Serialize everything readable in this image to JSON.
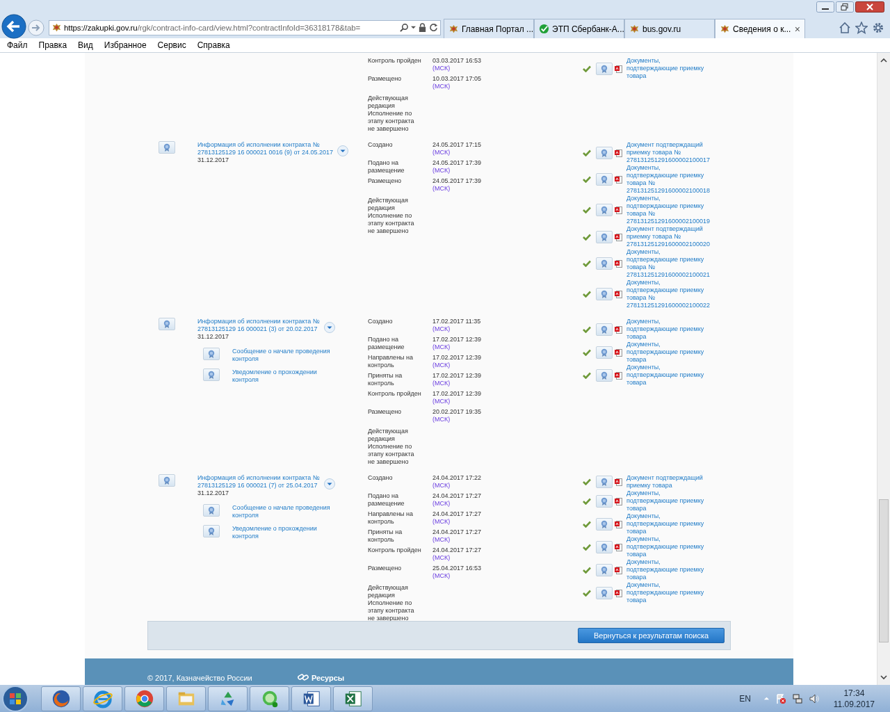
{
  "browser": {
    "url": {
      "host": "https://zakupki.gov.ru",
      "path": "/rgk/contract-info-card/view.html?contractInfoId=36318178&tab="
    },
    "tabs": [
      {
        "label": "Главная Портал ...",
        "kind": "emblem",
        "selected": false
      },
      {
        "label": "ЭТП Сбербанк-А...",
        "kind": "sber",
        "selected": false
      },
      {
        "label": "bus.gov.ru",
        "kind": "emblem",
        "selected": false
      },
      {
        "label": "Сведения о к...",
        "kind": "emblem",
        "selected": true,
        "close": "×"
      }
    ],
    "menu": [
      "Файл",
      "Правка",
      "Вид",
      "Избранное",
      "Сервис",
      "Справка"
    ]
  },
  "records": [
    {
      "events": [
        {
          "label": "Контроль пройден",
          "time": "03.03.2017 16:53",
          "zone": "(МСК)"
        },
        {
          "label": "Размещено",
          "time": "10.03.2017 17:05",
          "zone": "(МСК)"
        }
      ],
      "status": [
        "Действующая редакция",
        "Исполнение по этапу контракта не завершено"
      ],
      "documents": [
        "Документы, подтверждающие приемку товара"
      ]
    },
    {
      "title": [
        "Информация об исполнении контракта №",
        "27813125129 16 000021 0016 (9) от 24.05.2017"
      ],
      "end_date": "31.12.2017",
      "events": [
        {
          "label": "Создано",
          "time": "24.05.2017 17:15",
          "zone": "(МСК)"
        },
        {
          "label": "Подано на размещение",
          "time": "24.05.2017 17:39",
          "zone": "(МСК)"
        },
        {
          "label": "Размещено",
          "time": "24.05.2017 17:39",
          "zone": "(МСК)"
        }
      ],
      "status": [
        "Действующая редакция",
        "Исполнение по этапу контракта не завершено"
      ],
      "documents": [
        "Документ подтверждащий приемку товара № 278131251291600002100017",
        "Документы, подтверждающие приемку товара № 278131251291600002100018",
        "Документы, подтверждающие приемку товара № 278131251291600002100019",
        "Документ подтверждащий приемку товара № 278131251291600002100020",
        "Документы, подтверждающие приемку товара № 278131251291600002100021",
        "Документы, подтверждающие приемку товара № 278131251291600002100022"
      ]
    },
    {
      "title": [
        "Информация об исполнении контракта №",
        "27813125129 16 000021 (3) от 20.02.2017"
      ],
      "end_date": "31.12.2017",
      "sub_documents": [
        "Сообщение о начале проведения контроля",
        "Уведомление о прохождении контроля"
      ],
      "events": [
        {
          "label": "Создано",
          "time": "17.02.2017 11:35",
          "zone": "(МСК)"
        },
        {
          "label": "Подано на размещение",
          "time": "17.02.2017 12:39",
          "zone": "(МСК)"
        },
        {
          "label": "Направлены на контроль",
          "time": "17.02.2017 12:39",
          "zone": "(МСК)"
        },
        {
          "label": "Приняты на контроль",
          "time": "17.02.2017 12:39",
          "zone": "(МСК)"
        },
        {
          "label": "Контроль пройден",
          "time": "17.02.2017 12:39",
          "zone": "(МСК)"
        },
        {
          "label": "Размещено",
          "time": "20.02.2017 19:35",
          "zone": "(МСК)"
        }
      ],
      "status": [
        "Действующая редакция",
        "Исполнение по этапу контракта не завершено"
      ],
      "documents": [
        "Документы, подтверждающие приемку товара",
        "Документы, подтверждающие приемку товара",
        "Документы, подтверждающие приемку товара"
      ]
    },
    {
      "title": [
        "Информация об исполнении контракта №",
        "27813125129 16 000021 (7) от 25.04.2017"
      ],
      "end_date": "31.12.2017",
      "sub_documents": [
        "Сообщение о начале проведения контроля",
        "Уведомление о прохождении контроля"
      ],
      "events": [
        {
          "label": "Создано",
          "time": "24.04.2017 17:22",
          "zone": "(МСК)"
        },
        {
          "label": "Подано на размещение",
          "time": "24.04.2017 17:27",
          "zone": "(МСК)"
        },
        {
          "label": "Направлены на контроль",
          "time": "24.04.2017 17:27",
          "zone": "(МСК)"
        },
        {
          "label": "Приняты на контроль",
          "time": "24.04.2017 17:27",
          "zone": "(МСК)"
        },
        {
          "label": "Контроль пройден",
          "time": "24.04.2017 17:27",
          "zone": "(МСК)"
        },
        {
          "label": "Размещено",
          "time": "25.04.2017 16:53",
          "zone": "(МСК)"
        }
      ],
      "status": [
        "Действующая редакция",
        "Исполнение по этапу контракта не завершено"
      ],
      "documents": [
        "Документ подтверждащий приемку товара",
        "Документы, подтверждающие приемку товара",
        "Документы, подтверждающие приемку товара",
        "Документы, подтверждающие приемку товара",
        "Документы, подтверждающие приемку товара",
        "Документы, подтверждающие приемку товара"
      ]
    }
  ],
  "back_button": "Вернуться к результатам поиска",
  "footer": {
    "copyright": "© 2017, Казначейство России",
    "resources": "Ресурсы"
  },
  "taskbar": {
    "language": "EN",
    "time": "17:34",
    "date": "11.09.2017"
  }
}
